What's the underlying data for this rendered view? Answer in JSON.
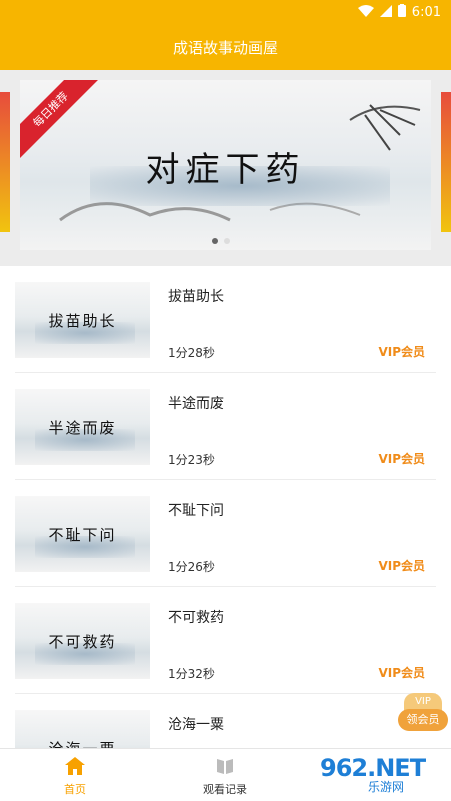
{
  "status_bar": {
    "time": "6:01"
  },
  "app_bar": {
    "title": "成语故事动画屋"
  },
  "banner": {
    "ribbon": "每日推荐",
    "title": "对症下药",
    "page_count": 2,
    "active_index": 0
  },
  "list": {
    "items": [
      {
        "thumb_title": "拔苗助长",
        "name": "拔苗助长",
        "duration": "1分28秒",
        "vip": "VIP会员"
      },
      {
        "thumb_title": "半途而废",
        "name": "半途而废",
        "duration": "1分23秒",
        "vip": "VIP会员"
      },
      {
        "thumb_title": "不耻下问",
        "name": "不耻下问",
        "duration": "1分26秒",
        "vip": "VIP会员"
      },
      {
        "thumb_title": "不可救药",
        "name": "不可救药",
        "duration": "1分32秒",
        "vip": "VIP会员"
      },
      {
        "thumb_title": "沧海一粟",
        "name": "沧海一粟",
        "duration": "",
        "vip": ""
      }
    ]
  },
  "vip_float": {
    "top": "VIP",
    "label": "领会员"
  },
  "bottom_nav": {
    "tabs": [
      {
        "label": "首页",
        "icon": "home-icon",
        "active": true
      },
      {
        "label": "观看记录",
        "icon": "book-icon",
        "active": false
      }
    ]
  },
  "watermark": {
    "brand": "962.NET",
    "sub": "乐游网"
  },
  "colors": {
    "primary": "#f7b500",
    "vip": "#f08c1a",
    "accent_nav": "#f7a100"
  }
}
